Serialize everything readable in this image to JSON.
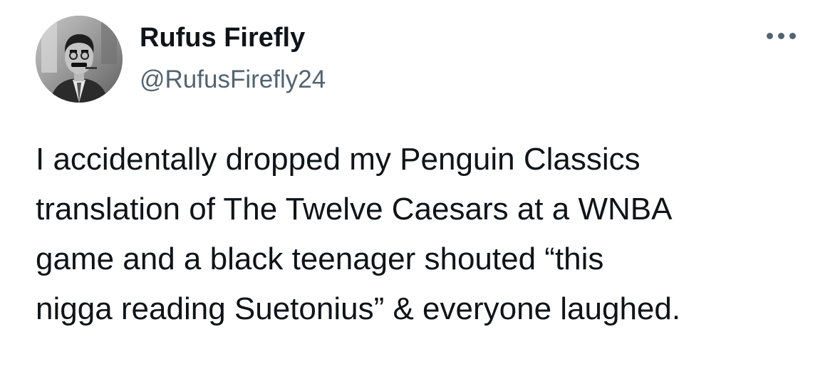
{
  "author": {
    "display_name": "Rufus Firefly",
    "handle": "@RufusFirefly24",
    "avatar_icon": "avatar-portrait-grayscale"
  },
  "more_icon": "more-horizontal-icon",
  "tweet": {
    "lines": [
      "I accidentally dropped my Penguin Classics",
      "translation of The Twelve Caesars at a WNBA",
      "game and a black teenager shouted “this",
      "nigga reading Suetonius” & everyone laughed."
    ]
  },
  "colors": {
    "text_primary": "#0f1419",
    "text_secondary": "#536471",
    "background": "#ffffff"
  }
}
